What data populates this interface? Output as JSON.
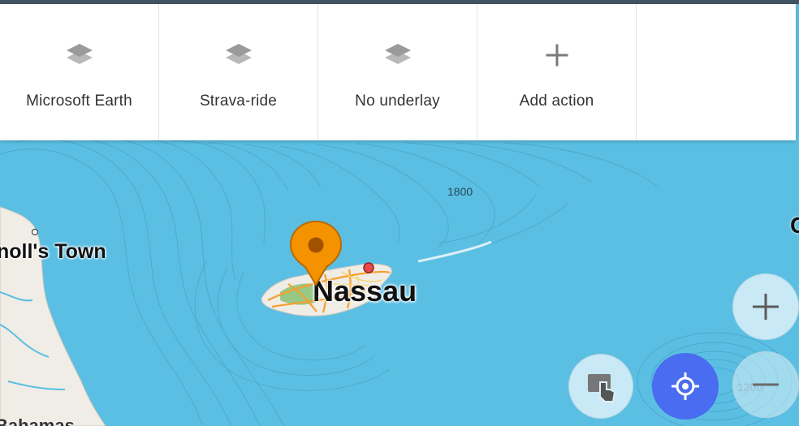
{
  "quick_actions": [
    {
      "label": "Microsoft Earth",
      "icon": "layers-icon"
    },
    {
      "label": "Strava-ride",
      "icon": "layers-icon"
    },
    {
      "label": "No underlay",
      "icon": "layers-icon"
    },
    {
      "label": "Add action",
      "icon": "plus-icon"
    }
  ],
  "map": {
    "city_label": "Nassau",
    "town_label": "noll's Town",
    "depth_label_1": "1800",
    "depth_label_2": "1200",
    "region_label": "Bahamas",
    "edge_label": "C"
  },
  "controls": {
    "zoom_in_icon": "plus-icon",
    "zoom_out_icon": "minus-icon",
    "map_mode_icon": "touch-hand-icon",
    "my_location_icon": "my-location-icon"
  },
  "colors": {
    "water": "#5bbfe3",
    "land": "#f0ece6",
    "accent_blue": "#4a6cf0",
    "pin_orange": "#f59200"
  }
}
